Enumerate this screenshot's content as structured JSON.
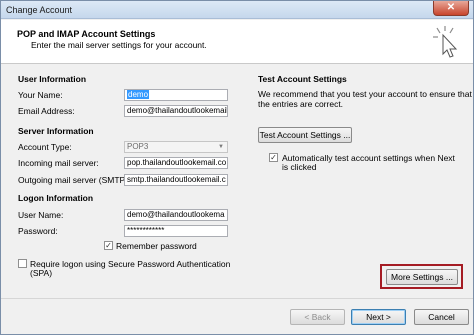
{
  "window": {
    "title": "Change Account",
    "close_glyph": "✕"
  },
  "header": {
    "title": "POP and IMAP Account Settings",
    "subtitle": "Enter the mail server settings for your account."
  },
  "user_info": {
    "heading": "User Information",
    "name_label": "Your Name:",
    "name_value": "demo",
    "email_label": "Email Address:",
    "email_value": "demo@thailandoutlookemail.co"
  },
  "server_info": {
    "heading": "Server Information",
    "account_type_label": "Account Type:",
    "account_type_value": "POP3",
    "incoming_label": "Incoming mail server:",
    "incoming_value": "pop.thailandoutlookemail.co",
    "outgoing_label": "Outgoing mail server (SMTP):",
    "outgoing_value": "smtp.thailandoutlookemail.c"
  },
  "logon_info": {
    "heading": "Logon Information",
    "username_label": "User Name:",
    "username_value": "demo@thailandoutlookema",
    "password_label": "Password:",
    "password_value": "************",
    "remember_label": "Remember password",
    "remember_checked": true,
    "spa_label_line1": "Require logon using Secure Password Authentication",
    "spa_label_line2": "(SPA)",
    "spa_checked": false
  },
  "test_settings": {
    "heading": "Test Account Settings",
    "description_line1": "We recommend that you test your account to ensure that",
    "description_line2": "the entries are correct.",
    "test_button": "Test Account Settings ...",
    "auto_test_line1": "Automatically test account settings when Next",
    "auto_test_line2": "is clicked",
    "auto_test_checked": true
  },
  "more_settings_button": "More Settings ...",
  "footer": {
    "back_button": "< Back",
    "next_button": "Next >",
    "cancel_button": "Cancel"
  },
  "icons": {
    "checkmark": "✓",
    "dropdown": "▼"
  },
  "colors": {
    "highlight": "#a51c24",
    "selection": "#3399ff"
  }
}
